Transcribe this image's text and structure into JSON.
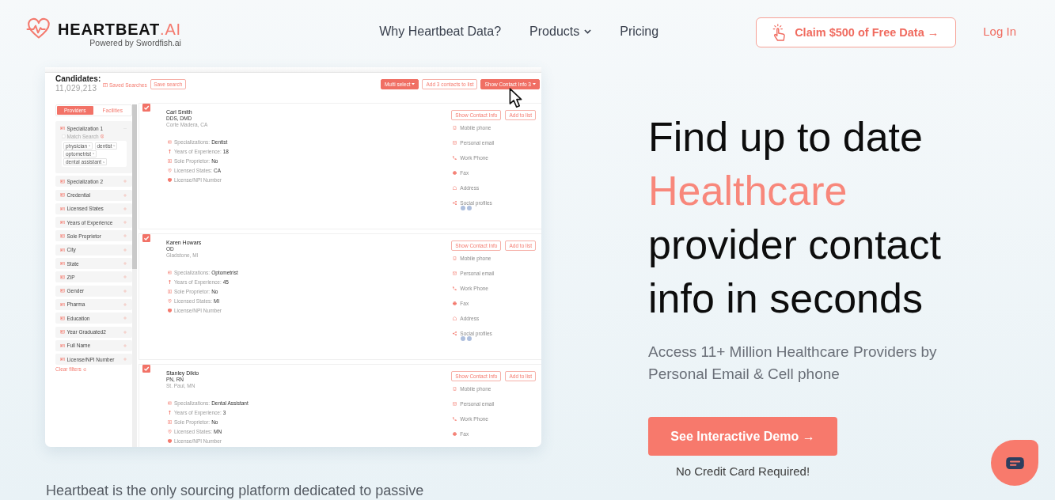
{
  "header": {
    "logo": {
      "brand": "HEARTBEAT",
      "suffix": ".AI",
      "tagline": "Powered by Swordfish.ai"
    },
    "nav": [
      {
        "label": "Why Heartbeat Data?",
        "kind": "link"
      },
      {
        "label": "Products",
        "kind": "dropdown"
      },
      {
        "label": "Pricing",
        "kind": "link"
      }
    ],
    "claim_button": "Claim $500 of Free Data →",
    "login": "Log In"
  },
  "app_preview": {
    "title": "Candidates:",
    "count": "11,029,213",
    "saved_searches": "Saved Searches",
    "save_search": "Save search",
    "actions": [
      {
        "label": "Multi select",
        "kind": "filled",
        "caret": true
      },
      {
        "label": "Add 3 contacts to list",
        "kind": "outline",
        "caret": false
      },
      {
        "label": "Show Contact Info 3",
        "kind": "filled",
        "caret": true
      }
    ],
    "filter_tabs": [
      {
        "label": "Providers",
        "selected": true
      },
      {
        "label": "Facilities",
        "selected": false
      }
    ],
    "filters": [
      {
        "label": "Specialization 1",
        "expanded": true,
        "match_search": {
          "label": "Match Search",
          "checked": false
        },
        "tags": [
          "physician",
          "dentist",
          "optometrist",
          "dental assistant"
        ]
      },
      {
        "label": "Specialization 2",
        "expanded": false
      },
      {
        "label": "Credential",
        "expanded": false
      },
      {
        "label": "Licensed States",
        "expanded": false
      },
      {
        "label": "Years of Experience",
        "expanded": false
      },
      {
        "label": "Sole Proprietor",
        "expanded": false
      },
      {
        "label": "City",
        "expanded": false
      },
      {
        "label": "State",
        "expanded": false
      },
      {
        "label": "ZIP",
        "expanded": false
      },
      {
        "label": "Gender",
        "expanded": false
      },
      {
        "label": "Pharma",
        "expanded": false
      },
      {
        "label": "Education",
        "expanded": false
      },
      {
        "label": "Year Graduated2",
        "expanded": false
      },
      {
        "label": "Full Name",
        "expanded": false
      },
      {
        "label": "License/NPI Number",
        "expanded": false
      }
    ],
    "clear_filters": "Clear filters",
    "candidates": [
      {
        "checked": true,
        "name": "Carl Smith",
        "credentials": "DDS, DMD",
        "location": "Corte Madera, CA",
        "attributes": [
          {
            "kind": "specialization",
            "label": "Specializations:",
            "value": "Dentist"
          },
          {
            "kind": "experience",
            "label": "Years of Experience:",
            "value": "18"
          },
          {
            "kind": "sole_proprietor",
            "label": "Sole Proprietor:",
            "value": "No"
          },
          {
            "kind": "licensed_states",
            "label": "Licensed States:",
            "value": "CA"
          },
          {
            "kind": "license",
            "label": "License/NPI Number"
          }
        ],
        "buttons": [
          "Show Contact Info",
          "Add to list"
        ],
        "contacts": [
          {
            "kind": "mobile",
            "label": "Mobile phone"
          },
          {
            "kind": "email",
            "label": "Personal email"
          },
          {
            "kind": "phone",
            "label": "Work Phone"
          },
          {
            "kind": "fax",
            "label": "Fax"
          },
          {
            "kind": "address",
            "label": "Address"
          },
          {
            "kind": "social",
            "label": "Social profiles"
          }
        ]
      },
      {
        "checked": true,
        "name": "Karen Howars",
        "credentials": "OD",
        "location": "Gladstone, MI",
        "attributes": [
          {
            "kind": "specialization",
            "label": "Specializations:",
            "value": "Optometrist"
          },
          {
            "kind": "experience",
            "label": "Years of Experience:",
            "value": "45"
          },
          {
            "kind": "sole_proprietor",
            "label": "Sole Proprietor:",
            "value": "No"
          },
          {
            "kind": "licensed_states",
            "label": "Licensed States:",
            "value": "MI"
          },
          {
            "kind": "license",
            "label": "License/NPI Number"
          }
        ],
        "buttons": [
          "Show Contact Info",
          "Add to list"
        ],
        "contacts": [
          {
            "kind": "mobile",
            "label": "Mobile phone"
          },
          {
            "kind": "email",
            "label": "Personal email"
          },
          {
            "kind": "phone",
            "label": "Work Phone"
          },
          {
            "kind": "fax",
            "label": "Fax"
          },
          {
            "kind": "address",
            "label": "Address"
          },
          {
            "kind": "social",
            "label": "Social profiles"
          }
        ]
      },
      {
        "checked": true,
        "name": "Stanley Dikto",
        "credentials": "PN, RN",
        "location": "St. Paul, MN",
        "attributes": [
          {
            "kind": "specialization",
            "label": "Specializations:",
            "value": "Dental Assistant"
          },
          {
            "kind": "experience",
            "label": "Years of Experience:",
            "value": "3"
          },
          {
            "kind": "sole_proprietor",
            "label": "Sole Proprietor:",
            "value": "No"
          },
          {
            "kind": "licensed_states",
            "label": "Licensed States:",
            "value": "MN"
          },
          {
            "kind": "license",
            "label": "License/NPI Number"
          }
        ],
        "buttons": [
          "Show Contact Info",
          "Add to list"
        ],
        "contacts": [
          {
            "kind": "mobile",
            "label": "Mobile phone"
          },
          {
            "kind": "email",
            "label": "Personal email"
          },
          {
            "kind": "phone",
            "label": "Work Phone"
          },
          {
            "kind": "fax",
            "label": "Fax"
          }
        ]
      }
    ]
  },
  "hero": {
    "heading": [
      {
        "text": "Find up to date",
        "accent": false
      },
      {
        "text": "Healthcare",
        "accent": true
      },
      {
        "text": "provider contact info in seconds",
        "accent": false
      }
    ],
    "subtitle": "Access 11+ Million Healthcare Providers by Personal Email & Cell phone",
    "cta": "See Interactive Demo →",
    "cta_note": "No Credit Card Required!"
  },
  "intro": "Heartbeat is the only sourcing platform dedicated to passive"
}
